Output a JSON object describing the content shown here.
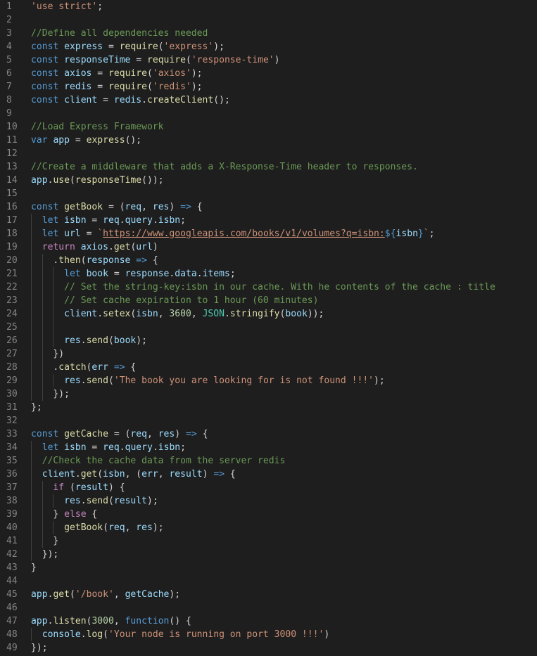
{
  "editor": {
    "theme": {
      "background": "#1e1e1e",
      "line_number_color": "#858585",
      "indent_guide_color": "#404040"
    },
    "colors": {
      "kw": "#569cd6",
      "ctl": "#c586c0",
      "var": "#9cdcfe",
      "fn": "#dcdcaa",
      "str": "#ce9178",
      "num": "#b5cea8",
      "cmt": "#6a9955",
      "cls": "#4ec9b0",
      "pun": "#d4d4d4"
    },
    "lines": [
      {
        "n": "1",
        "tokens": [
          [
            "str",
            "'use strict'"
          ],
          [
            "pun",
            ";"
          ]
        ]
      },
      {
        "n": "2",
        "tokens": []
      },
      {
        "n": "3",
        "tokens": [
          [
            "cmt",
            "//Define all dependencies needed"
          ]
        ]
      },
      {
        "n": "4",
        "tokens": [
          [
            "kw",
            "const"
          ],
          [
            "pun",
            " "
          ],
          [
            "var",
            "express"
          ],
          [
            "pun",
            " = "
          ],
          [
            "fn",
            "require"
          ],
          [
            "pun",
            "("
          ],
          [
            "str",
            "'express'"
          ],
          [
            "pun",
            ");"
          ]
        ]
      },
      {
        "n": "5",
        "tokens": [
          [
            "kw",
            "const"
          ],
          [
            "pun",
            " "
          ],
          [
            "var",
            "responseTime"
          ],
          [
            "pun",
            " = "
          ],
          [
            "fn",
            "require"
          ],
          [
            "pun",
            "("
          ],
          [
            "str",
            "'response-time'"
          ],
          [
            "pun",
            ")"
          ]
        ]
      },
      {
        "n": "6",
        "tokens": [
          [
            "kw",
            "const"
          ],
          [
            "pun",
            " "
          ],
          [
            "var",
            "axios"
          ],
          [
            "pun",
            " = "
          ],
          [
            "fn",
            "require"
          ],
          [
            "pun",
            "("
          ],
          [
            "str",
            "'axios'"
          ],
          [
            "pun",
            ");"
          ]
        ]
      },
      {
        "n": "7",
        "tokens": [
          [
            "kw",
            "const"
          ],
          [
            "pun",
            " "
          ],
          [
            "var",
            "redis"
          ],
          [
            "pun",
            " = "
          ],
          [
            "fn",
            "require"
          ],
          [
            "pun",
            "("
          ],
          [
            "str",
            "'redis'"
          ],
          [
            "pun",
            ");"
          ]
        ]
      },
      {
        "n": "8",
        "tokens": [
          [
            "kw",
            "const"
          ],
          [
            "pun",
            " "
          ],
          [
            "var",
            "client"
          ],
          [
            "pun",
            " = "
          ],
          [
            "var",
            "redis"
          ],
          [
            "pun",
            "."
          ],
          [
            "fn",
            "createClient"
          ],
          [
            "pun",
            "();"
          ]
        ]
      },
      {
        "n": "9",
        "tokens": []
      },
      {
        "n": "10",
        "tokens": [
          [
            "cmt",
            "//Load Express Framework"
          ]
        ]
      },
      {
        "n": "11",
        "tokens": [
          [
            "kw",
            "var"
          ],
          [
            "pun",
            " "
          ],
          [
            "var",
            "app"
          ],
          [
            "pun",
            " = "
          ],
          [
            "fn",
            "express"
          ],
          [
            "pun",
            "();"
          ]
        ]
      },
      {
        "n": "12",
        "tokens": []
      },
      {
        "n": "13",
        "tokens": [
          [
            "cmt",
            "//Create a middleware that adds a X-Response-Time header to responses."
          ]
        ]
      },
      {
        "n": "14",
        "tokens": [
          [
            "var",
            "app"
          ],
          [
            "pun",
            "."
          ],
          [
            "fn",
            "use"
          ],
          [
            "pun",
            "("
          ],
          [
            "fn",
            "responseTime"
          ],
          [
            "pun",
            "());"
          ]
        ]
      },
      {
        "n": "15",
        "tokens": []
      },
      {
        "n": "16",
        "tokens": [
          [
            "kw",
            "const"
          ],
          [
            "pun",
            " "
          ],
          [
            "fn",
            "getBook"
          ],
          [
            "pun",
            " = ("
          ],
          [
            "var",
            "req"
          ],
          [
            "pun",
            ", "
          ],
          [
            "var",
            "res"
          ],
          [
            "pun",
            ") "
          ],
          [
            "kw",
            "=>"
          ],
          [
            "pun",
            " {"
          ]
        ]
      },
      {
        "n": "17",
        "tokens": [
          [
            "pun",
            "  "
          ],
          [
            "kw",
            "let"
          ],
          [
            "pun",
            " "
          ],
          [
            "var",
            "isbn"
          ],
          [
            "pun",
            " = "
          ],
          [
            "var",
            "req"
          ],
          [
            "pun",
            "."
          ],
          [
            "var",
            "query"
          ],
          [
            "pun",
            "."
          ],
          [
            "var",
            "isbn"
          ],
          [
            "pun",
            ";"
          ]
        ]
      },
      {
        "n": "18",
        "tokens": [
          [
            "pun",
            "  "
          ],
          [
            "kw",
            "let"
          ],
          [
            "pun",
            " "
          ],
          [
            "var",
            "url"
          ],
          [
            "pun",
            " = "
          ],
          [
            "str",
            "`"
          ],
          [
            "url",
            "https://www.googleapis.com/books/v1/volumes?q=isbn:"
          ],
          [
            "ibr",
            "${"
          ],
          [
            "var",
            "isbn"
          ],
          [
            "ibr",
            "}"
          ],
          [
            "str",
            "`"
          ],
          [
            "pun",
            ";"
          ]
        ]
      },
      {
        "n": "19",
        "tokens": [
          [
            "pun",
            "  "
          ],
          [
            "ctl",
            "return"
          ],
          [
            "pun",
            " "
          ],
          [
            "var",
            "axios"
          ],
          [
            "pun",
            "."
          ],
          [
            "fn",
            "get"
          ],
          [
            "pun",
            "("
          ],
          [
            "var",
            "url"
          ],
          [
            "pun",
            ")"
          ]
        ]
      },
      {
        "n": "20",
        "tokens": [
          [
            "pun",
            "    ."
          ],
          [
            "fn",
            "then"
          ],
          [
            "pun",
            "("
          ],
          [
            "var",
            "response"
          ],
          [
            "pun",
            " "
          ],
          [
            "kw",
            "=>"
          ],
          [
            "pun",
            " {"
          ]
        ]
      },
      {
        "n": "21",
        "tokens": [
          [
            "pun",
            "      "
          ],
          [
            "kw",
            "let"
          ],
          [
            "pun",
            " "
          ],
          [
            "var",
            "book"
          ],
          [
            "pun",
            " = "
          ],
          [
            "var",
            "response"
          ],
          [
            "pun",
            "."
          ],
          [
            "var",
            "data"
          ],
          [
            "pun",
            "."
          ],
          [
            "var",
            "items"
          ],
          [
            "pun",
            ";"
          ]
        ]
      },
      {
        "n": "22",
        "tokens": [
          [
            "pun",
            "      "
          ],
          [
            "cmt",
            "// Set the string-key:isbn in our cache. With he contents of the cache : title"
          ]
        ]
      },
      {
        "n": "23",
        "tokens": [
          [
            "pun",
            "      "
          ],
          [
            "cmt",
            "// Set cache expiration to 1 hour (60 minutes)"
          ]
        ]
      },
      {
        "n": "24",
        "tokens": [
          [
            "pun",
            "      "
          ],
          [
            "var",
            "client"
          ],
          [
            "pun",
            "."
          ],
          [
            "fn",
            "setex"
          ],
          [
            "pun",
            "("
          ],
          [
            "var",
            "isbn"
          ],
          [
            "pun",
            ", "
          ],
          [
            "num",
            "3600"
          ],
          [
            "pun",
            ", "
          ],
          [
            "cls",
            "JSON"
          ],
          [
            "pun",
            "."
          ],
          [
            "fn",
            "stringify"
          ],
          [
            "pun",
            "("
          ],
          [
            "var",
            "book"
          ],
          [
            "pun",
            "));"
          ]
        ]
      },
      {
        "n": "25",
        "tokens": []
      },
      {
        "n": "26",
        "tokens": [
          [
            "pun",
            "      "
          ],
          [
            "var",
            "res"
          ],
          [
            "pun",
            "."
          ],
          [
            "fn",
            "send"
          ],
          [
            "pun",
            "("
          ],
          [
            "var",
            "book"
          ],
          [
            "pun",
            ");"
          ]
        ]
      },
      {
        "n": "27",
        "tokens": [
          [
            "pun",
            "    })"
          ]
        ]
      },
      {
        "n": "28",
        "tokens": [
          [
            "pun",
            "    ."
          ],
          [
            "fn",
            "catch"
          ],
          [
            "pun",
            "("
          ],
          [
            "var",
            "err"
          ],
          [
            "pun",
            " "
          ],
          [
            "kw",
            "=>"
          ],
          [
            "pun",
            " {"
          ]
        ]
      },
      {
        "n": "29",
        "tokens": [
          [
            "pun",
            "      "
          ],
          [
            "var",
            "res"
          ],
          [
            "pun",
            "."
          ],
          [
            "fn",
            "send"
          ],
          [
            "pun",
            "("
          ],
          [
            "str",
            "'The book you are looking for is not found !!!'"
          ],
          [
            "pun",
            ");"
          ]
        ]
      },
      {
        "n": "30",
        "tokens": [
          [
            "pun",
            "    });"
          ]
        ]
      },
      {
        "n": "31",
        "tokens": [
          [
            "pun",
            "};"
          ]
        ]
      },
      {
        "n": "32",
        "tokens": []
      },
      {
        "n": "33",
        "tokens": [
          [
            "kw",
            "const"
          ],
          [
            "pun",
            " "
          ],
          [
            "fn",
            "getCache"
          ],
          [
            "pun",
            " = ("
          ],
          [
            "var",
            "req"
          ],
          [
            "pun",
            ", "
          ],
          [
            "var",
            "res"
          ],
          [
            "pun",
            ") "
          ],
          [
            "kw",
            "=>"
          ],
          [
            "pun",
            " {"
          ]
        ]
      },
      {
        "n": "34",
        "tokens": [
          [
            "pun",
            "  "
          ],
          [
            "kw",
            "let"
          ],
          [
            "pun",
            " "
          ],
          [
            "var",
            "isbn"
          ],
          [
            "pun",
            " = "
          ],
          [
            "var",
            "req"
          ],
          [
            "pun",
            "."
          ],
          [
            "var",
            "query"
          ],
          [
            "pun",
            "."
          ],
          [
            "var",
            "isbn"
          ],
          [
            "pun",
            ";"
          ]
        ]
      },
      {
        "n": "35",
        "tokens": [
          [
            "pun",
            "  "
          ],
          [
            "cmt",
            "//Check the cache data from the server redis"
          ]
        ]
      },
      {
        "n": "36",
        "tokens": [
          [
            "pun",
            "  "
          ],
          [
            "var",
            "client"
          ],
          [
            "pun",
            "."
          ],
          [
            "fn",
            "get"
          ],
          [
            "pun",
            "("
          ],
          [
            "var",
            "isbn"
          ],
          [
            "pun",
            ", ("
          ],
          [
            "var",
            "err"
          ],
          [
            "pun",
            ", "
          ],
          [
            "var",
            "result"
          ],
          [
            "pun",
            ") "
          ],
          [
            "kw",
            "=>"
          ],
          [
            "pun",
            " {"
          ]
        ]
      },
      {
        "n": "37",
        "tokens": [
          [
            "pun",
            "    "
          ],
          [
            "ctl",
            "if"
          ],
          [
            "pun",
            " ("
          ],
          [
            "var",
            "result"
          ],
          [
            "pun",
            ") {"
          ]
        ]
      },
      {
        "n": "38",
        "tokens": [
          [
            "pun",
            "      "
          ],
          [
            "var",
            "res"
          ],
          [
            "pun",
            "."
          ],
          [
            "fn",
            "send"
          ],
          [
            "pun",
            "("
          ],
          [
            "var",
            "result"
          ],
          [
            "pun",
            ");"
          ]
        ]
      },
      {
        "n": "39",
        "tokens": [
          [
            "pun",
            "    } "
          ],
          [
            "ctl",
            "else"
          ],
          [
            "pun",
            " {"
          ]
        ]
      },
      {
        "n": "40",
        "tokens": [
          [
            "pun",
            "      "
          ],
          [
            "fn",
            "getBook"
          ],
          [
            "pun",
            "("
          ],
          [
            "var",
            "req"
          ],
          [
            "pun",
            ", "
          ],
          [
            "var",
            "res"
          ],
          [
            "pun",
            ");"
          ]
        ]
      },
      {
        "n": "41",
        "tokens": [
          [
            "pun",
            "    }"
          ]
        ]
      },
      {
        "n": "42",
        "tokens": [
          [
            "pun",
            "  });"
          ]
        ]
      },
      {
        "n": "43",
        "tokens": [
          [
            "pun",
            "}"
          ]
        ]
      },
      {
        "n": "44",
        "tokens": []
      },
      {
        "n": "45",
        "tokens": [
          [
            "var",
            "app"
          ],
          [
            "pun",
            "."
          ],
          [
            "fn",
            "get"
          ],
          [
            "pun",
            "("
          ],
          [
            "str",
            "'/book'"
          ],
          [
            "pun",
            ", "
          ],
          [
            "var",
            "getCache"
          ],
          [
            "pun",
            ");"
          ]
        ]
      },
      {
        "n": "46",
        "tokens": []
      },
      {
        "n": "47",
        "tokens": [
          [
            "var",
            "app"
          ],
          [
            "pun",
            "."
          ],
          [
            "fn",
            "listen"
          ],
          [
            "pun",
            "("
          ],
          [
            "num",
            "3000"
          ],
          [
            "pun",
            ", "
          ],
          [
            "kw",
            "function"
          ],
          [
            "pun",
            "() {"
          ]
        ]
      },
      {
        "n": "48",
        "tokens": [
          [
            "pun",
            "  "
          ],
          [
            "var",
            "console"
          ],
          [
            "pun",
            "."
          ],
          [
            "fn",
            "log"
          ],
          [
            "pun",
            "("
          ],
          [
            "str",
            "'Your node is running on port 3000 !!!'"
          ],
          [
            "pun",
            ")"
          ]
        ]
      },
      {
        "n": "49",
        "tokens": [
          [
            "pun",
            "});"
          ]
        ]
      }
    ]
  }
}
